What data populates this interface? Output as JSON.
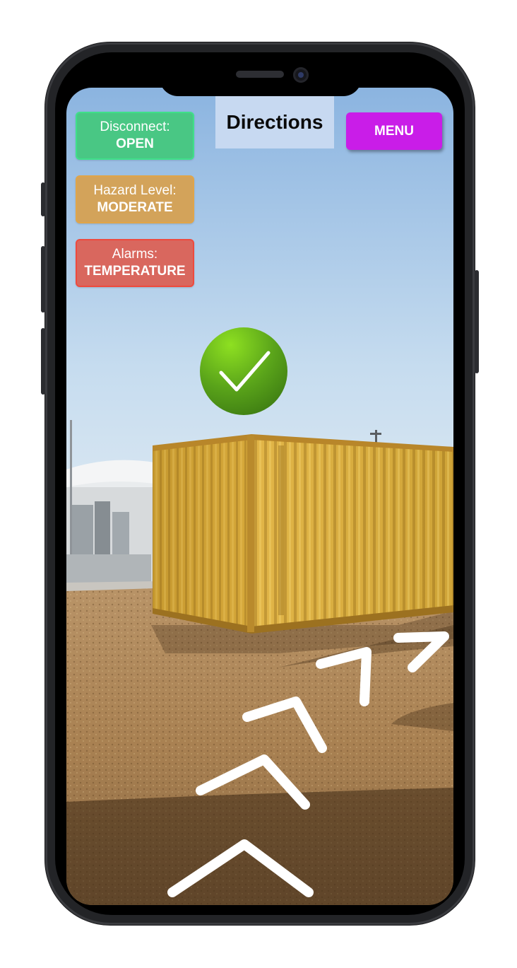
{
  "status_boxes": {
    "disconnect": {
      "label": "Disconnect:",
      "value": "OPEN"
    },
    "hazard": {
      "label": "Hazard Level:",
      "value": "MODERATE"
    },
    "alarms": {
      "label": "Alarms:",
      "value": "TEMPERATURE"
    }
  },
  "header": {
    "title": "Directions"
  },
  "menu": {
    "label": "MENU"
  },
  "icons": {
    "status": "check-circle-icon",
    "directions": "direction-arrow-icon"
  },
  "colors": {
    "disconnect_bg": "#49c784",
    "hazard_bg": "#d3a35a",
    "alarms_bg": "#d9675e",
    "menu_bg": "#c91de8",
    "directions_bg": "#c7d9f1"
  }
}
